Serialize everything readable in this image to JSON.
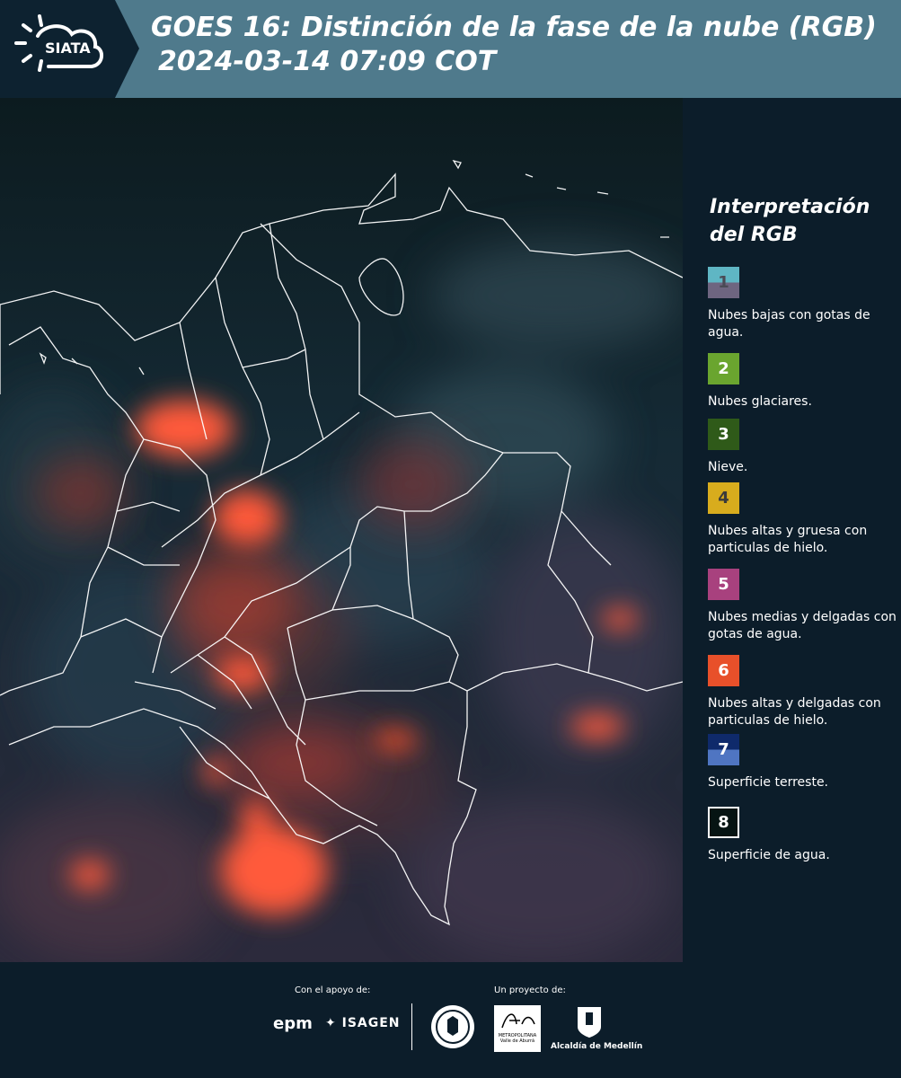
{
  "header": {
    "logo_text": "SIATA",
    "title": "GOES 16: Distinción de la fase de la nube (RGB)",
    "datetime": "2024-03-14 07:09 COT"
  },
  "legend": {
    "title": "Interpretación del RGB",
    "items": [
      {
        "number": "1",
        "label": "Nubes bajas con gotas de agua.",
        "color_top": "#5fb6c4",
        "color_bottom": "#6e6580",
        "text_color": "#4a4a55"
      },
      {
        "number": "2",
        "label": "Nubes glaciares.",
        "color_top": "#6aa52f",
        "color_bottom": "#6aa52f",
        "text_color": "#ffffff"
      },
      {
        "number": "3",
        "label": "Nieve.",
        "color_top": "#2f5a19",
        "color_bottom": "#2f5a19",
        "text_color": "#ffffff"
      },
      {
        "number": "4",
        "label": "Nubes altas y gruesa con particulas de hielo.",
        "color_top": "#d8ac1d",
        "color_bottom": "#d8ac1d",
        "text_color": "#3a3a3a"
      },
      {
        "number": "5",
        "label": "Nubes medias y delgadas con gotas de agua.",
        "color_top": "#a8417e",
        "color_bottom": "#a8417e",
        "text_color": "#ffffff"
      },
      {
        "number": "6",
        "label": "Nubes altas y delgadas con particulas de hielo.",
        "color_top": "#e8502a",
        "color_bottom": "#e8502a",
        "text_color": "#ffffff"
      },
      {
        "number": "7",
        "label": "Superficie terreste.",
        "color_top": "#0f2a6b",
        "color_bottom": "#4f75c2",
        "text_color": "#ffffff"
      },
      {
        "number": "8",
        "label": "Superficie de agua.",
        "color_top": "#061413",
        "color_bottom": "#061413",
        "text_color": "#ffffff"
      }
    ]
  },
  "footer": {
    "support_label": "Con el apoyo de:",
    "project_label": "Un proyecto de:",
    "sponsor_1": "epm",
    "sponsor_2": "ISAGEN",
    "partner_1_text": "METROPOLITANA Valle de Aburrá",
    "partner_2": "Alcaldía de Medellín"
  },
  "colors": {
    "header_bg": "#4f7a8c",
    "page_bg": "#0c1d2a",
    "cloud_red": "#ff5a3a"
  }
}
